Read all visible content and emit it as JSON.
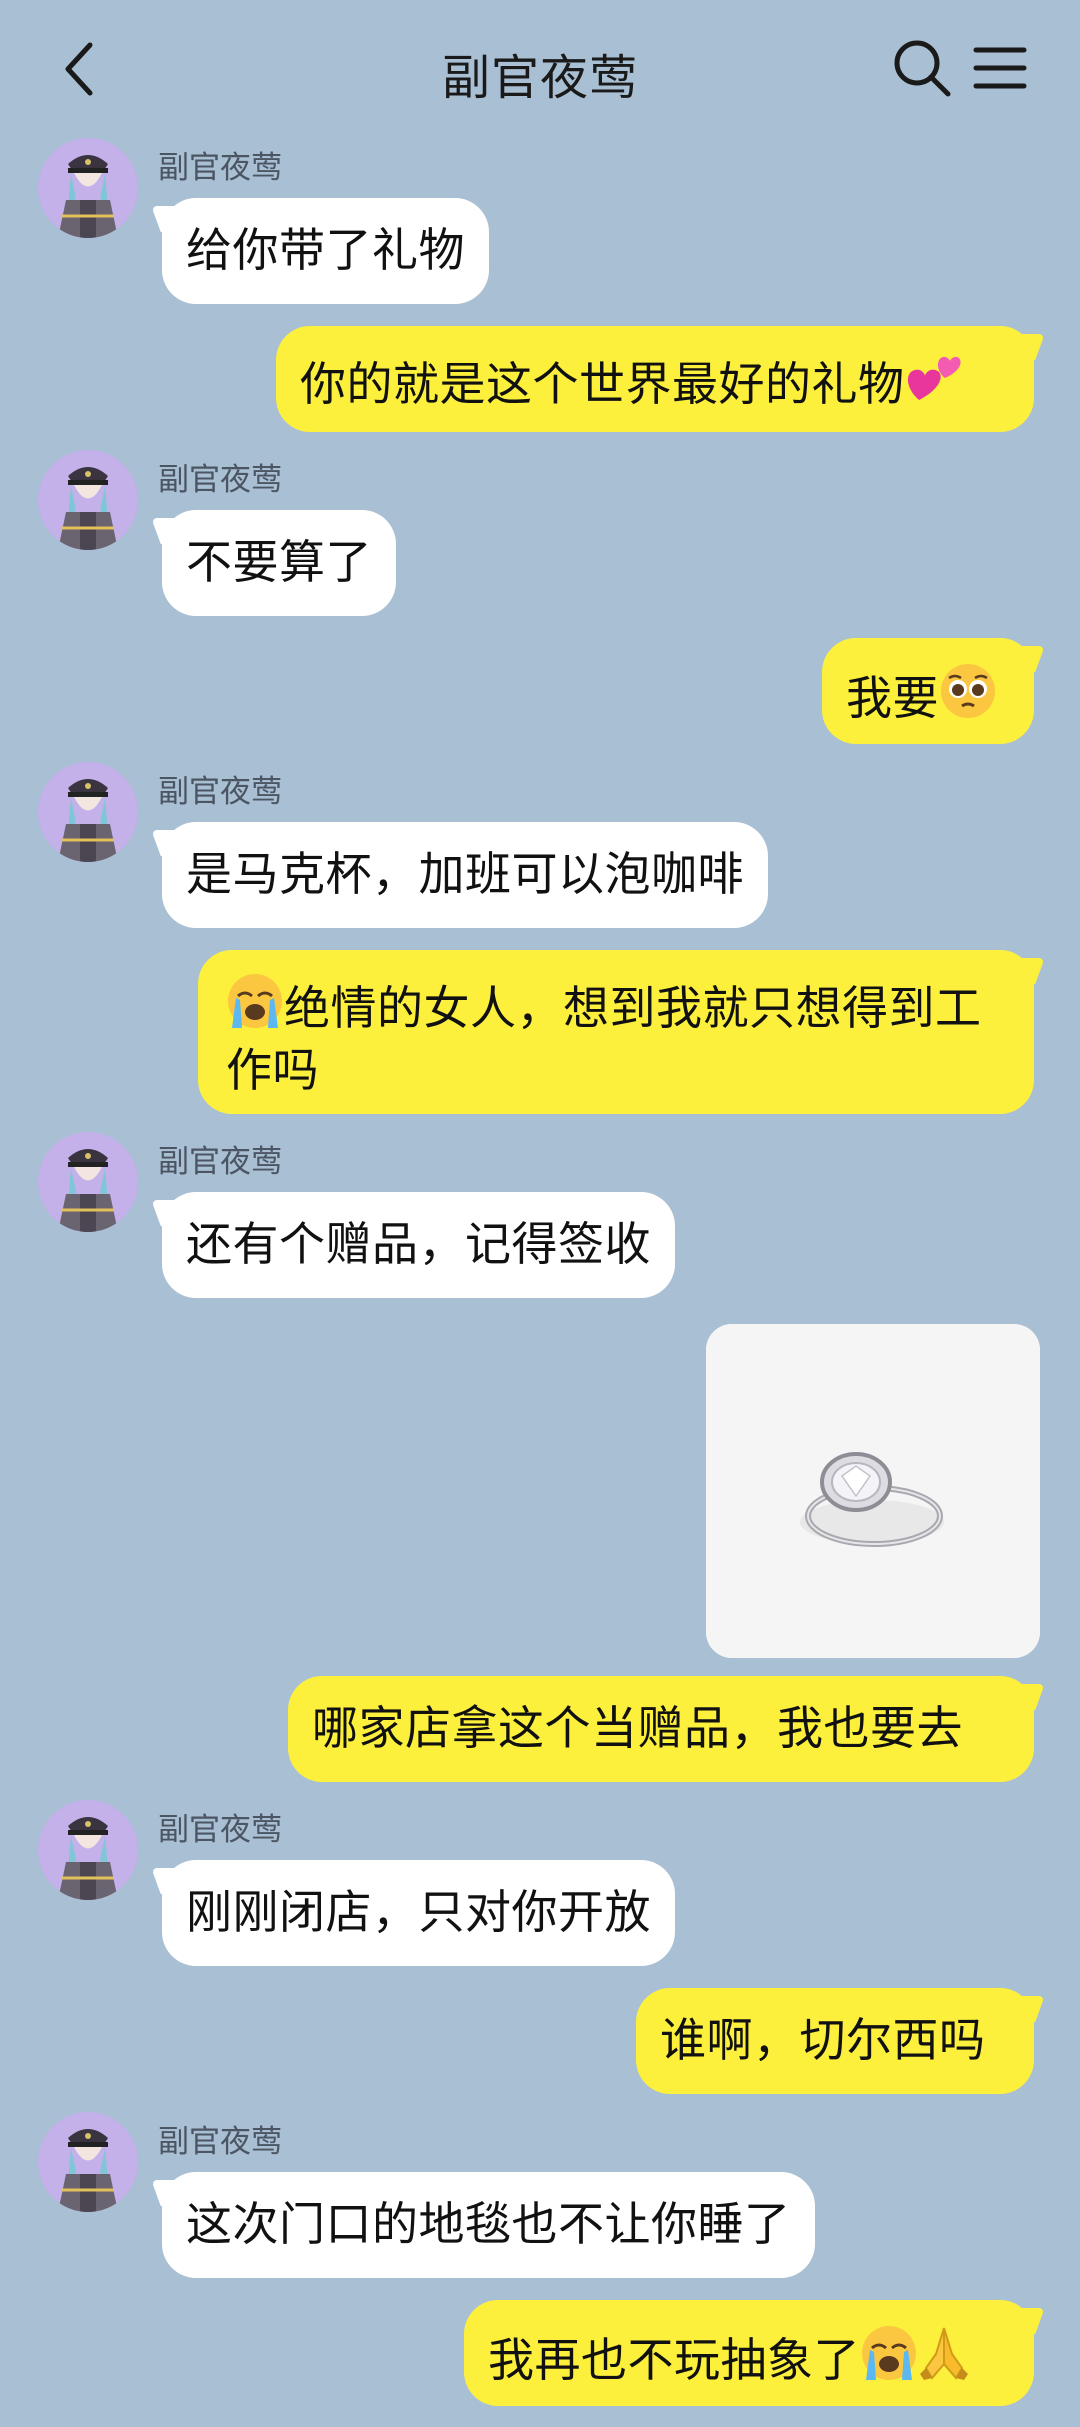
{
  "header": {
    "title": "副官夜莺",
    "back_icon": "chevron-left-icon",
    "search_icon": "search-icon",
    "menu_icon": "hamburger-menu-icon"
  },
  "colors": {
    "background": "#a9bfd3",
    "incoming_bubble": "#ffffff",
    "outgoing_bubble": "#fdf03c",
    "avatar_bg": "#bda9e6"
  },
  "messages": [
    {
      "sender": "副官夜莺",
      "text": "给你带了礼物"
    },
    {
      "text": "你的就是这个世界最好的礼物",
      "emoji": "two-hearts-icon"
    },
    {
      "sender": "副官夜莺",
      "text": "不要算了"
    },
    {
      "text": "我要",
      "emoji": "pleading-face-icon"
    },
    {
      "sender": "副官夜莺",
      "text": "是马克杯，加班可以泡咖啡"
    },
    {
      "emoji": "loudly-crying-face-icon",
      "text": "绝情的女人，想到我就只想得到工作吗"
    },
    {
      "sender": "副官夜莺",
      "text": "还有个赠品，记得签收"
    },
    {
      "image": "ring-image"
    },
    {
      "text": "哪家店拿这个当赠品，我也要去"
    },
    {
      "sender": "副官夜莺",
      "text": "刚刚闭店，只对你开放"
    },
    {
      "text": "谁啊，切尔西吗"
    },
    {
      "sender": "副官夜莺",
      "text": "这次门口的地毯也不让你睡了"
    },
    {
      "text": "我再也不玩抽象了",
      "emoji": "loudly-crying-face-icon",
      "emoji2": "folded-hands-icon"
    }
  ]
}
